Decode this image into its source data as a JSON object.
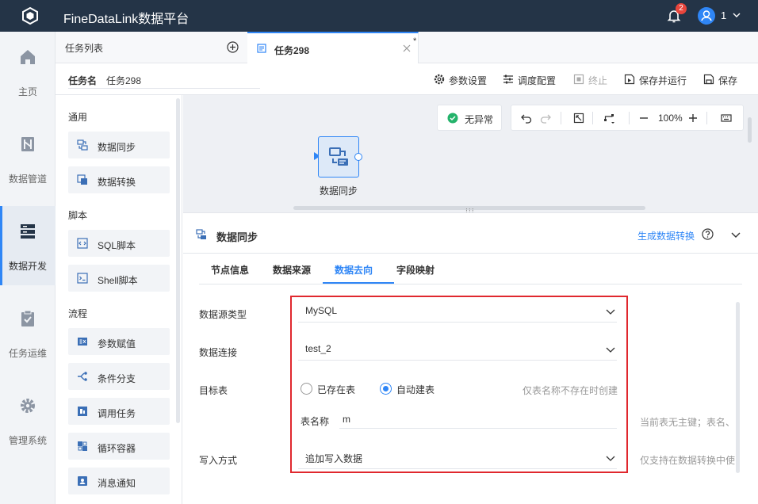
{
  "app": {
    "title": "FineDataLink数据平台",
    "notification_count": "2",
    "user_name": "1"
  },
  "nav": {
    "items": [
      {
        "label": "主页",
        "icon": "home-icon"
      },
      {
        "label": "数据管道",
        "icon": "pipeline-icon"
      },
      {
        "label": "数据开发",
        "icon": "server-icon",
        "active": true
      },
      {
        "label": "任务运维",
        "icon": "clipboard-check-icon"
      },
      {
        "label": "管理系统",
        "icon": "gear-icon"
      }
    ]
  },
  "tasklist": {
    "label": "任务列表"
  },
  "tab": {
    "title": "任务298",
    "modified": "*"
  },
  "task": {
    "name_label": "任务名",
    "name_value": "任务298"
  },
  "toolbar": {
    "params": "参数设置",
    "schedule": "调度配置",
    "stop": "终止",
    "save_run": "保存并运行",
    "save": "保存"
  },
  "palette": {
    "groups": [
      "通用",
      "脚本",
      "流程"
    ],
    "items": [
      "数据同步",
      "数据转换",
      "SQL脚本",
      "Shell脚本",
      "参数赋值",
      "条件分支",
      "调用任务",
      "循环容器",
      "消息通知"
    ]
  },
  "canvas": {
    "status": "无异常",
    "zoom": "100%",
    "node_label": "数据同步"
  },
  "panel": {
    "title": "数据同步",
    "link": "生成数据转换",
    "tabs": [
      "节点信息",
      "数据来源",
      "数据去向",
      "字段映射"
    ],
    "active_tab": 2,
    "fields": {
      "source_type_label": "数据源类型",
      "source_type_value": "MySQL",
      "connection_label": "数据连接",
      "connection_value": "test_2",
      "target_label": "目标表",
      "opt_existing": "已存在表",
      "opt_auto": "自动建表",
      "auto_hint": "仅表名称不存在时创建",
      "table_name_label": "表名称",
      "table_name_value": "m",
      "table_hint": "当前表无主键；表名、",
      "write_label": "写入方式",
      "write_value": "追加写入数据",
      "write_hint": "仅支持在数据转换中使"
    }
  },
  "colors": {
    "accent": "#2f86f6",
    "topbar": "#243447",
    "highlight": "#e0282e"
  }
}
